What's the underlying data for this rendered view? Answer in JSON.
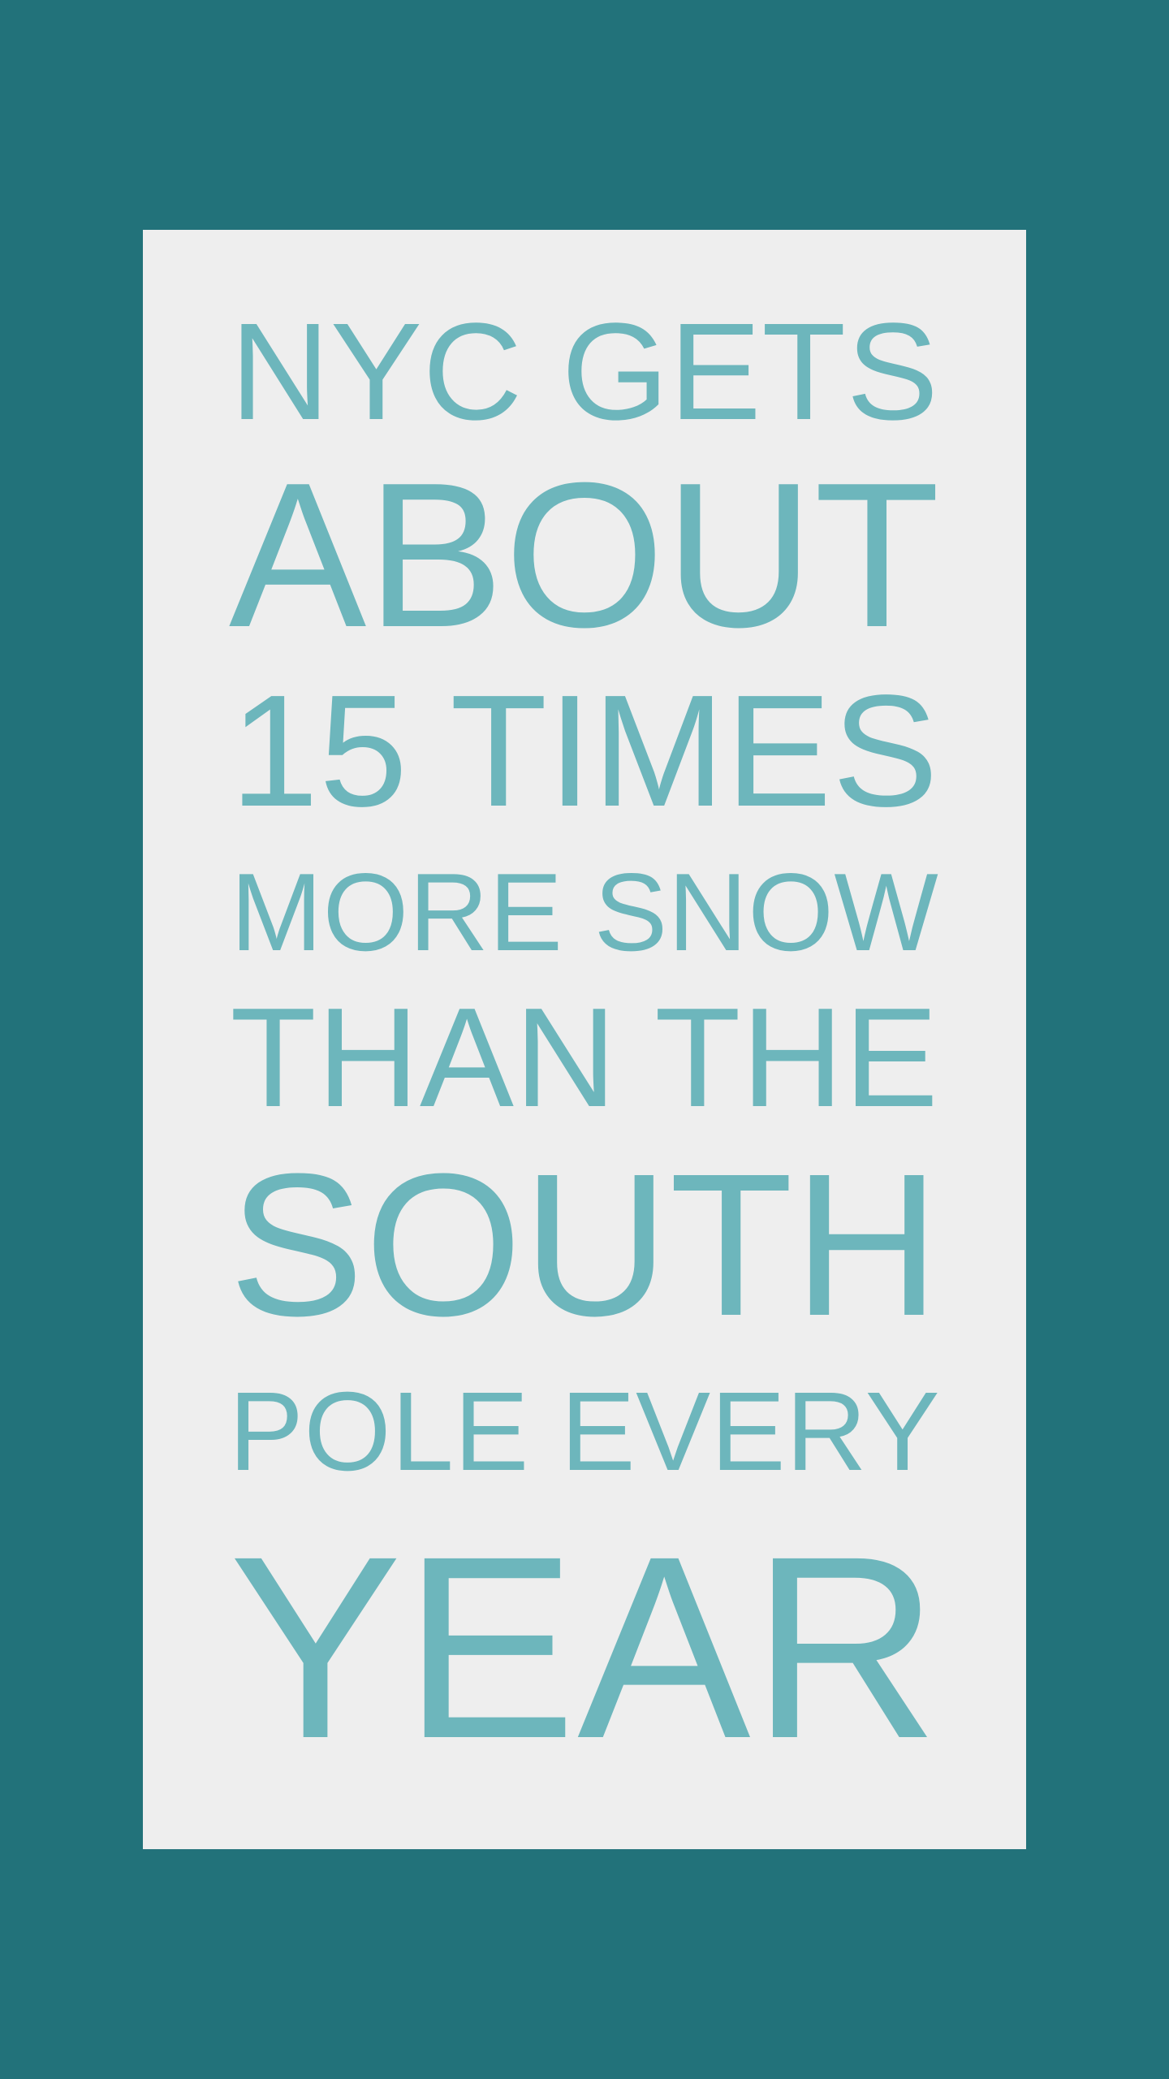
{
  "poster": {
    "lines": [
      "NYC GETS",
      "ABOUT",
      "15 TIMES",
      "MORE SNOW",
      "THAN THE",
      "SOUTH",
      "POLE EVERY",
      "YEAR"
    ]
  },
  "colors": {
    "background": "#22727a",
    "panel": "#eeeeee",
    "text": "#6db6bc"
  }
}
